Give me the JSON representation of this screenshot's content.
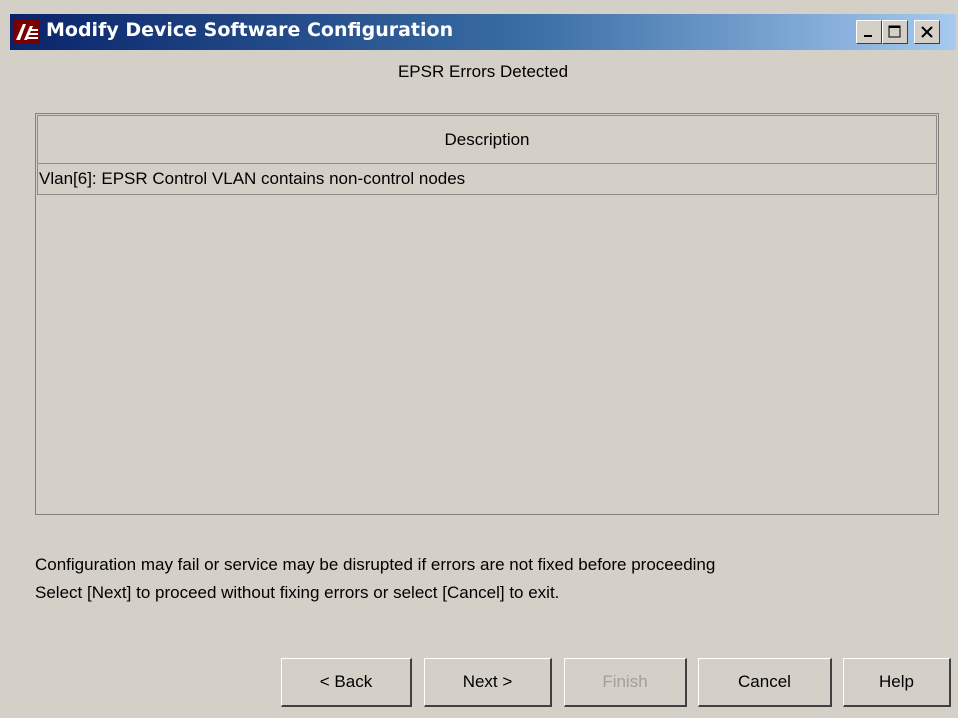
{
  "window": {
    "title": "Modify Device Software Configuration",
    "controls": {
      "minimize_icon": "minimize-icon",
      "maximize_icon": "maximize-icon",
      "close_icon": "close-icon"
    }
  },
  "header": {
    "title": "EPSR Errors Detected"
  },
  "table": {
    "columns": [
      "Description"
    ],
    "rows": [
      "Vlan[6]: EPSR Control VLAN contains non-control nodes"
    ]
  },
  "message": {
    "line1": "Configuration may fail or service may be disrupted if errors are not fixed before proceeding",
    "line2": "Select [Next] to proceed without fixing errors or select [Cancel] to exit."
  },
  "buttons": {
    "back": "< Back",
    "next": "Next >",
    "finish": "Finish",
    "cancel": "Cancel",
    "help": "Help"
  },
  "colors": {
    "titlebar_start": "#0a246a",
    "titlebar_end": "#a6caf0",
    "window_bg": "#d4d0c8",
    "disabled_text": "#a0a0a0"
  }
}
